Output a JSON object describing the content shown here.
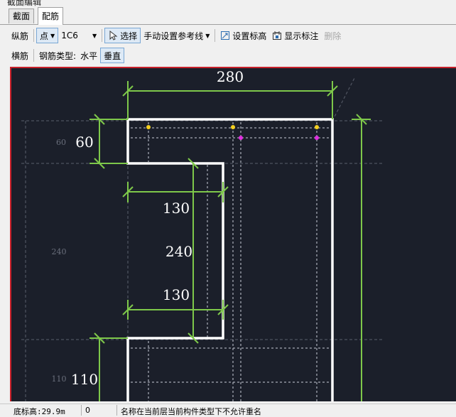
{
  "window": {
    "title": "截面编辑"
  },
  "tabs": [
    {
      "label": "截面"
    },
    {
      "label": "配筋"
    }
  ],
  "toolbar1": {
    "longitudinal_label": "纵筋",
    "point_label": "点",
    "rebar_value": "1C6",
    "select_label": "选择",
    "manual_ref_label": "手动设置参考线",
    "set_elevation_label": "设置标高",
    "show_dims_label": "显示标注",
    "delete_label": "删除"
  },
  "toolbar2": {
    "transverse_label": "横筋",
    "rebar_type_label": "钢筋类型:",
    "horizontal_label": "水平",
    "vertical_label": "垂直"
  },
  "drawing": {
    "dims": {
      "top_width": "280",
      "flange": "60",
      "web_top": "130",
      "web_height": "240",
      "web_bottom": "130",
      "bottom": "110"
    },
    "side_labels": {
      "flange": "60",
      "web": "240",
      "bottom": "110"
    },
    "colors": {
      "background": "#1b1f2a",
      "outline": "#ffffff",
      "dimension": "#7ec84a",
      "ref_line": "#c8ccd8",
      "rebar_a": "#f5d020",
      "rebar_b": "#e030e0"
    }
  },
  "status": {
    "base_elevation": "底标高:29.9m",
    "value": "0",
    "message": "名称在当前层当前构件类型下不允许重名"
  }
}
